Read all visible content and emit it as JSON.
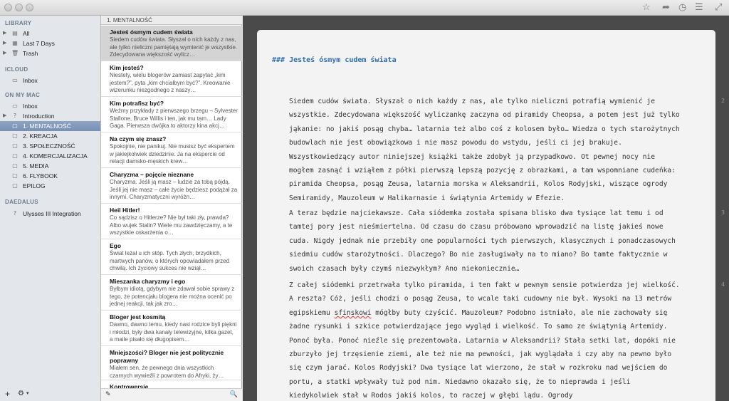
{
  "sidebar": {
    "sections": [
      {
        "title": "LIBRARY",
        "items": [
          {
            "label": "All",
            "icon": "books-icon"
          },
          {
            "label": "Last 7 Days",
            "icon": "calendar-icon"
          },
          {
            "label": "Trash",
            "icon": "trash-icon"
          }
        ]
      },
      {
        "title": "ICLOUD",
        "items": [
          {
            "label": "Inbox",
            "icon": "inbox-icon"
          }
        ]
      },
      {
        "title": "ON MY MAC",
        "items": [
          {
            "label": "Inbox",
            "icon": "inbox-icon"
          },
          {
            "label": "Introduction",
            "icon": "help-icon"
          },
          {
            "label": "1. MENTALNOŚĆ",
            "icon": "group-icon",
            "selected": true
          },
          {
            "label": "2. KREACJA",
            "icon": "group-icon"
          },
          {
            "label": "3. SPOŁECZNOŚĆ",
            "icon": "group-icon"
          },
          {
            "label": "4. KOMERCJALIZACJA",
            "icon": "group-icon"
          },
          {
            "label": "5. MEDIA",
            "icon": "group-icon"
          },
          {
            "label": "6. FLYBOOK",
            "icon": "group-icon"
          },
          {
            "label": "EPILOG",
            "icon": "group-icon"
          }
        ]
      },
      {
        "title": "DAEDALUS",
        "items": [
          {
            "label": "Ulysses III Integration",
            "icon": "help-icon"
          }
        ]
      }
    ],
    "footer": {
      "add": "+",
      "settings": "⚙"
    }
  },
  "sheetlist": {
    "header": "1. MENTALNOŚĆ",
    "sheets": [
      {
        "title": "Jesteś ósmym cudem świata",
        "excerpt": "Siedem cudów świata. Słyszał o nich każdy z nas, ale tylko nieliczni pamiętają wymienić je wszystkie. Zdecydowana większość wylicz…",
        "selected": true
      },
      {
        "title": "Kim jesteś?",
        "excerpt": "Niestety, wielu blogerów zamiast zapytać „kim jestem?”, pyta „kim chciałbym być?”. Kreowanie wizerunku niezgodnego z naszy…"
      },
      {
        "title": "Kim potrafisz być?",
        "excerpt": "Weźmy przykłady z pierwszego brzegu – Sylvester Stallone, Bruce Willis i ten, jak mu tam… Lady Gaga. Pierwsza dwójka to aktorzy kina akcj…"
      },
      {
        "title": "Na czym się znasz?",
        "excerpt": "Spokojnie, nie panikuj. Nie musisz być ekspertem w jakiejkolwiek dziedzinie. Ja na ekspercie od relacji damsko-męskich krew…"
      },
      {
        "title": "Charyzma – pojęcie nieznane",
        "excerpt": "Charyzma. Jeśli ją masz – ludzie za tobą pójdą. Jeśli jej nie masz – całe życie będziesz podążał za innymi. Charyzmatyczni wyróżn…"
      },
      {
        "title": "Heil Hitler!",
        "excerpt": "Co sądzisz o Hitlerze? Nie był taki zły, prawda? Albo wujek Stalin? Wiele mu zawdzięczamy, a te wszystkie oskarżenia o…"
      },
      {
        "title": "Ego",
        "excerpt": "Świat leżał u ich stóp. Tych złych, brzydkich, martwych panów, o których opowiadałem przed chwilą. Ich życiowy sukces nie wziął…"
      },
      {
        "title": "Mieszanka charyzmy i ego",
        "excerpt": "Byłbym idiotą, gdybym nie zdawał sobie sprawy z tego, że potencjału blogera nie można ocenić po jednej reakcji, tak jak zro…"
      },
      {
        "title": "Bloger jest kosmitą",
        "excerpt": "Dawno, dawno temu, kiedy nasi rodzice byli piękni i młodzi, były dwa kanały telewizyjne, kilka gazet, a maile pisało się długopisem…"
      },
      {
        "title": "Mniejszości? Bloger nie jest politycznie poprawny",
        "excerpt": "Miałem sen, że pewnego dnia wszystkich czarnych wywieźli z powrotem do Afryki, ży…"
      },
      {
        "title": "Kontrowersje",
        "excerpt": ""
      }
    ],
    "footer": {
      "new_sheet": "✎",
      "search": "🔍"
    }
  },
  "toolbar": {
    "icons": [
      "star-icon",
      "share-icon",
      "history-icon",
      "list-icon",
      "fullscreen-icon"
    ]
  },
  "editor": {
    "title": "### Jesteś ósmym cudem świata",
    "paragraphs": [
      "Siedem cudów świata. Słyszał o nich każdy z nas, ale tylko nieliczni potrafią wymienić je wszystkie. Zdecydowana większość wyliczankę zaczyna od piramidy Cheopsa, a potem jest już tylko jąkanie: no jakiś posąg chyba… latarnia też albo coś z kolosem było… Wiedza o tych starożytnych budowlach nie jest obowiązkowa i nie masz powodu do wstydu, jeśli ci jej brakuje. Wszystkowiedzący autor niniejszej książki także zdobył ją przypadkowo. Ot pewnej nocy nie mogłem zasnąć i wziąłem z półki pierwszą lepszą pozycję z obrazkami,   a tam wspomniane cudeńka: piramida Cheopsa, posąg Zeusa, latarnia morska w Aleksandrii, Kolos Rodyjski, wiszące ogrody Semiramidy, Mauzoleum w Halikarnasie i świątynia Artemidy w Efezie.",
      "A teraz będzie najciekawsze. Cała siódemka została spisana blisko dwa tysiące lat temu i od tamtej pory jest nieśmiertelna. Od czasu do czasu próbowano wprowadzić na listę jakieś nowe cuda. Nigdy jednak nie przebiły one popularności tych pierwszych, klasycznych i ponadczasowych siedmiu cudów starożytności. Dlaczego? Bo nie zasługiwały na to miano? Bo tamte faktycznie w swoich czasach były czymś niezwykłym? Ano niekoniecznie…"
    ],
    "para3_before": "Z całej siódemki przetrwała tylko piramida, i ten fakt w pewnym sensie potwierdza jej wielkość. A reszta? Cóż, jeśli chodzi o posąg Zeusa, to wcale taki cudowny nie był. Wysoki na 13 metrów egipskiemu ",
    "para3_misspelled": "sfinskowi",
    "para3_after": " mógłby buty czyścić. Mauzoleum? Podobno istniało, ale nie zachowały się żadne rysunki i szkice potwierdzające jego wygląd i wielkość. To samo ze świątynią Artemidy. Ponoć była. Ponoć nieźle się prezentowała. Latarnia w Aleksandrii? Stała setki lat, dopóki nie zburzyło jej trzęsienie ziemi, ale też nie ma pewności, jak wyglądała i czy aby na pewno było się czym jarać. Kolos Rodyjski? Dwa tysiące lat wierzono, że stał w rozkroku nad wejściem do portu, a statki wpływały tuż pod nim. Niedawno okazało się, że to nieprawda i jeśli kiedykolwiek stał w Rodos jakiś kolos, to raczej w głębi lądu. Ogrody",
    "margin_numbers": [
      "2",
      "3",
      "4"
    ]
  }
}
